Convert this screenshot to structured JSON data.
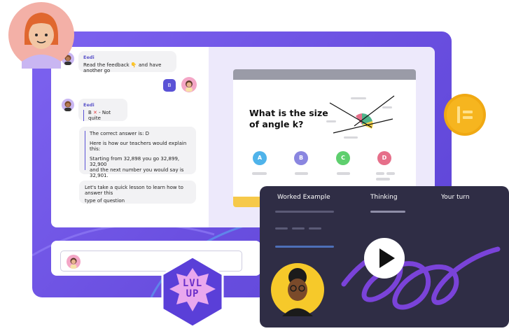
{
  "chat": {
    "sender": "Eedi",
    "msg1": "Read the feedback 👇 and have another go",
    "user_reply": "B",
    "msg2_answer": "B",
    "msg2_status": "- Not quite",
    "explain_line1": "The correct answer is: D",
    "explain_line2": "Here is how our teachers would explain this:",
    "explain_line3a": "Starting from 32,898 you go 32,899, 32,900",
    "explain_line3b": "and the next number you would say is 32,901.",
    "lesson_line1": "Let's take a quick lesson to learn how to answer this",
    "lesson_line2": "type of question"
  },
  "question": {
    "title": "What is the size of angle k?",
    "options": [
      "A",
      "B",
      "C",
      "D"
    ]
  },
  "video": {
    "tabs": [
      "Worked Example",
      "Thinking",
      "Your turn"
    ]
  },
  "badge": {
    "line1": "LVL",
    "line2": "UP"
  },
  "colors": {
    "frame": "#6a4fe0",
    "option_a": "#4fb3ea",
    "option_b": "#8a86e0",
    "option_c": "#5ecf6e",
    "option_d": "#e66f8a",
    "coin": "#f6b51f",
    "video_bg": "#2f2d45"
  },
  "icons": [
    "coin-logo-icon",
    "play-icon",
    "cross-icon",
    "point-down-icon"
  ]
}
